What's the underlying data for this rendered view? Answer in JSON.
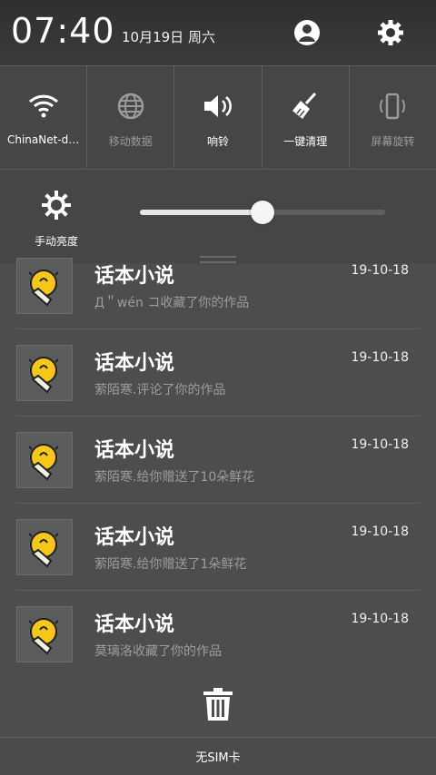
{
  "status": {
    "time": "07:40",
    "date": "10月19日 周六"
  },
  "quick_toggles": [
    {
      "label": "ChinaNet-d…",
      "icon": "wifi-icon",
      "active": true
    },
    {
      "label": "移动数据",
      "icon": "globe-icon",
      "active": false
    },
    {
      "label": "响铃",
      "icon": "speaker-icon",
      "active": true
    },
    {
      "label": "一键清理",
      "icon": "broom-icon",
      "active": true
    },
    {
      "label": "屏幕旋转",
      "icon": "rotate-phone-icon",
      "active": false
    }
  ],
  "brightness": {
    "label": "手动亮度",
    "level_percent": 50
  },
  "notifications": [
    {
      "app": "话本小说",
      "time": "19-10-18",
      "text": "Д＂wén コ收藏了你的作品"
    },
    {
      "app": "话本小说",
      "time": "19-10-18",
      "text": "萦陌寒.评论了你的作品"
    },
    {
      "app": "话本小说",
      "time": "19-10-18",
      "text": "萦陌寒.给你赠送了10朵鲜花"
    },
    {
      "app": "话本小说",
      "time": "19-10-18",
      "text": "萦陌寒.给你赠送了1朵鲜花"
    },
    {
      "app": "话本小说",
      "time": "19-10-18",
      "text": "莫璃洛收藏了你的作品"
    }
  ],
  "carrier": "无SIM卡",
  "colors": {
    "background": "#4c4d4d",
    "accent_icon": "#f4c430"
  }
}
